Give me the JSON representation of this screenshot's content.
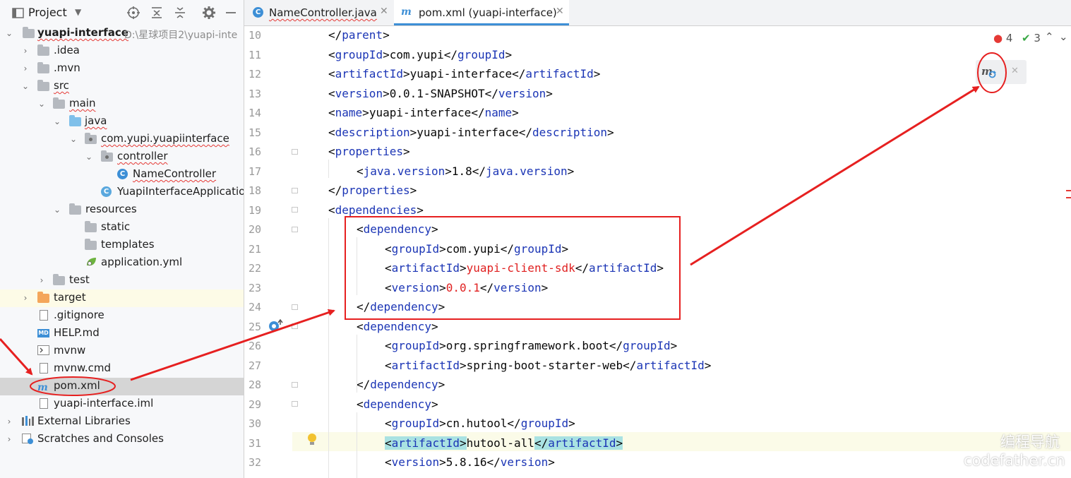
{
  "project_panel": {
    "title": "Project",
    "toolbar_icons": [
      "locate-icon",
      "expand-all-icon",
      "collapse-all-icon",
      "gear-icon",
      "minimize-icon"
    ],
    "tree": [
      {
        "label": "yuapi-interface",
        "path": "D:\\星球项目2\\yuapi-inte",
        "icon": "module-folder-icon"
      },
      {
        "label": ".idea",
        "icon": "folder-icon"
      },
      {
        "label": ".mvn",
        "icon": "folder-icon"
      },
      {
        "label": "src",
        "icon": "folder-icon"
      },
      {
        "label": "main",
        "icon": "folder-icon"
      },
      {
        "label": "java",
        "icon": "source-folder-icon"
      },
      {
        "label": "com.yupi.yuapiinterface",
        "icon": "package-icon"
      },
      {
        "label": "controller",
        "icon": "package-icon"
      },
      {
        "label": "NameController",
        "icon": "class-icon"
      },
      {
        "label": "YuapiInterfaceApplicatio",
        "icon": "spring-class-icon"
      },
      {
        "label": "resources",
        "icon": "resources-folder-icon"
      },
      {
        "label": "static",
        "icon": "folder-icon"
      },
      {
        "label": "templates",
        "icon": "folder-icon"
      },
      {
        "label": "application.yml",
        "icon": "spring-config-icon"
      },
      {
        "label": "test",
        "icon": "folder-icon"
      },
      {
        "label": "target",
        "icon": "excluded-folder-icon"
      },
      {
        "label": ".gitignore",
        "icon": "file-icon"
      },
      {
        "label": "HELP.md",
        "icon": "markdown-icon"
      },
      {
        "label": "mvnw",
        "icon": "terminal-file-icon"
      },
      {
        "label": "mvnw.cmd",
        "icon": "file-icon"
      },
      {
        "label": "pom.xml",
        "icon": "maven-icon"
      },
      {
        "label": "yuapi-interface.iml",
        "icon": "file-icon"
      },
      {
        "label": "External Libraries",
        "icon": "libraries-icon"
      },
      {
        "label": "Scratches and Consoles",
        "icon": "scratches-icon"
      }
    ]
  },
  "tabs": [
    {
      "label": "NameController.java",
      "icon": "class-icon",
      "active": false
    },
    {
      "label": "pom.xml (yuapi-interface)",
      "icon": "maven-icon",
      "active": true
    }
  ],
  "editor": {
    "inspections": {
      "errors": "4",
      "ok": "3"
    },
    "lines": [
      {
        "n": "10",
        "t": [
          [
            "t",
            "</parent>"
          ]
        ]
      },
      {
        "n": "11",
        "t": [
          [
            "t",
            "<groupId>"
          ],
          [
            "p",
            "com.yupi"
          ],
          [
            "t",
            "</groupId>"
          ]
        ]
      },
      {
        "n": "12",
        "t": [
          [
            "t",
            "<artifactId>"
          ],
          [
            "p",
            "yuapi-interface"
          ],
          [
            "t",
            "</artifactId>"
          ]
        ]
      },
      {
        "n": "13",
        "t": [
          [
            "t",
            "<version>"
          ],
          [
            "p",
            "0.0.1-SNAPSHOT"
          ],
          [
            "t",
            "</version>"
          ]
        ]
      },
      {
        "n": "14",
        "t": [
          [
            "t",
            "<name>"
          ],
          [
            "p",
            "yuapi-interface"
          ],
          [
            "t",
            "</name>"
          ]
        ]
      },
      {
        "n": "15",
        "t": [
          [
            "t",
            "<description>"
          ],
          [
            "p",
            "yuapi-interface"
          ],
          [
            "t",
            "</description>"
          ]
        ]
      },
      {
        "n": "16",
        "t": [
          [
            "t",
            "<properties>"
          ]
        ]
      },
      {
        "n": "17",
        "t": [
          [
            "t",
            "<java.version>"
          ],
          [
            "p",
            "1.8"
          ],
          [
            "t",
            "</java.version>"
          ]
        ]
      },
      {
        "n": "18",
        "t": [
          [
            "t",
            "</properties>"
          ]
        ]
      },
      {
        "n": "19",
        "t": [
          [
            "t",
            "<dependencies>"
          ]
        ]
      },
      {
        "n": "20",
        "t": [
          [
            "t",
            "<dependency>"
          ]
        ]
      },
      {
        "n": "21",
        "t": [
          [
            "t",
            "<groupId>"
          ],
          [
            "p",
            "com.yupi"
          ],
          [
            "t",
            "</groupId>"
          ]
        ]
      },
      {
        "n": "22",
        "t": [
          [
            "t",
            "<artifactId>"
          ],
          [
            "r",
            "yuapi-client-sdk"
          ],
          [
            "t",
            "</artifactId>"
          ]
        ]
      },
      {
        "n": "23",
        "t": [
          [
            "t",
            "<version>"
          ],
          [
            "r",
            "0.0.1"
          ],
          [
            "t",
            "</version>"
          ]
        ]
      },
      {
        "n": "24",
        "t": [
          [
            "t",
            "</dependency>"
          ]
        ]
      },
      {
        "n": "25",
        "t": [
          [
            "t",
            "<dependency>"
          ]
        ]
      },
      {
        "n": "26",
        "t": [
          [
            "t",
            "<groupId>"
          ],
          [
            "p",
            "org.springframework.boot"
          ],
          [
            "t",
            "</groupId>"
          ]
        ]
      },
      {
        "n": "27",
        "t": [
          [
            "t",
            "<artifactId>"
          ],
          [
            "p",
            "spring-boot-starter-web"
          ],
          [
            "t",
            "</artifactId>"
          ]
        ]
      },
      {
        "n": "28",
        "t": [
          [
            "t",
            "</dependency>"
          ]
        ]
      },
      {
        "n": "29",
        "t": [
          [
            "t",
            "<dependency>"
          ]
        ]
      },
      {
        "n": "30",
        "t": [
          [
            "t",
            "<groupId>"
          ],
          [
            "p",
            "cn.hutool"
          ],
          [
            "t",
            "</groupId>"
          ]
        ]
      },
      {
        "n": "31",
        "t": [
          [
            "h",
            "<artifactId>"
          ],
          [
            "p",
            "hutool-all"
          ],
          [
            "h",
            "</artifactId>"
          ]
        ]
      },
      {
        "n": "32",
        "t": [
          [
            "t",
            "<version>"
          ],
          [
            "p",
            "5.8.16"
          ],
          [
            "t",
            "</version>"
          ]
        ]
      }
    ]
  },
  "watermark": {
    "line1": "编程导航",
    "line2": "codefather.cn"
  },
  "colors": {
    "annotation_red": "#e62020",
    "accent": "#3d8fd6",
    "tag": "#1b35b5"
  }
}
